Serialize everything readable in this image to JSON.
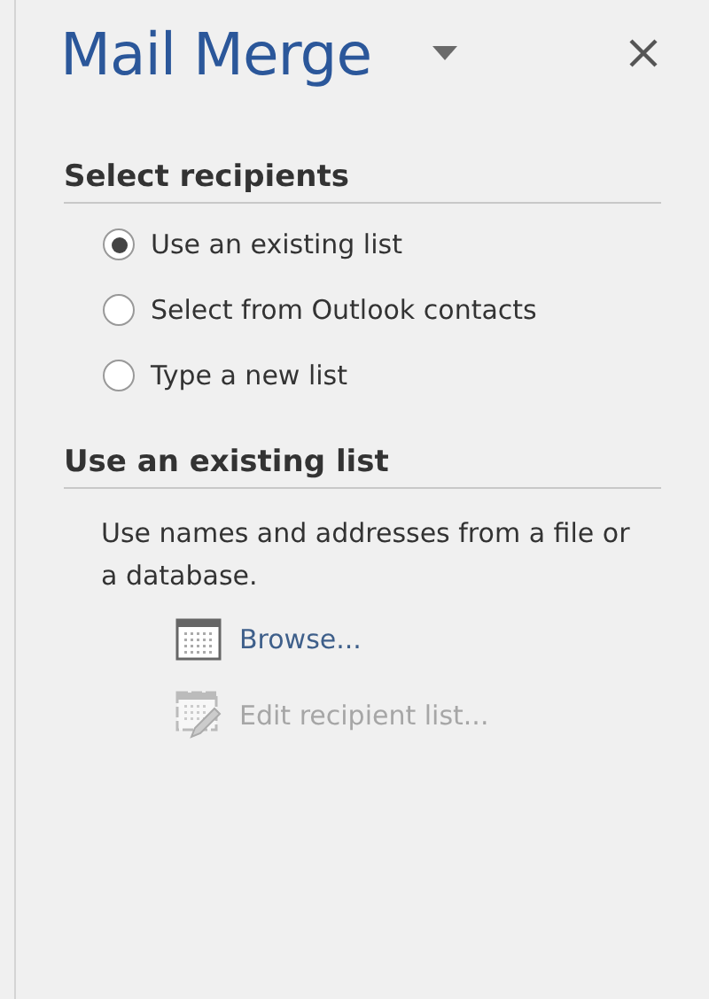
{
  "pane": {
    "title": "Mail Merge"
  },
  "sections": [
    {
      "heading": "Select recipients",
      "options": [
        {
          "label": "Use an existing list",
          "selected": true
        },
        {
          "label": "Select from Outlook contacts",
          "selected": false
        },
        {
          "label": "Type a new list",
          "selected": false
        }
      ]
    },
    {
      "heading": "Use an existing list",
      "description": "Use names and addresses from a file or a database.",
      "actions": [
        {
          "kind": "browse",
          "label": "Browse...",
          "disabled": false
        },
        {
          "kind": "edit",
          "label": "Edit recipient list...",
          "disabled": true
        }
      ]
    }
  ]
}
